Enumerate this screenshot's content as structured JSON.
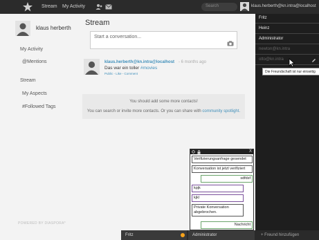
{
  "header": {
    "app_name": "Stream",
    "nav_activity": "My Activity",
    "search_placeholder": "Search",
    "user_label": "klaus.herberth@kn.intra@localhost"
  },
  "sidebar": {
    "profile_name": "klaus herberth",
    "items": [
      "My Activity",
      "@Mentions",
      "Stream",
      "My Aspects",
      "#Followed Tags"
    ],
    "powered_by": "POWERED BY DIASPORA*"
  },
  "stream": {
    "title": "Stream",
    "composer_placeholder": "Start a conversation...",
    "post": {
      "author": "klaus.herberth@kn.intra@localhost",
      "time": "- 6 months ago",
      "text_prefix": "Das war ein toller ",
      "tag": "#movies",
      "meta": "Public - Like - Comment"
    },
    "notice": {
      "line1": "You should add some more contacts!",
      "line2_prefix": "You can search or invite more contacts. Or you can share with ",
      "line2_link": "community spotlight."
    }
  },
  "chat": {
    "close_glyph": "X",
    "messages": [
      {
        "text": "Verifizierungsanfrage gesendet",
        "kind": "in"
      },
      {
        "text": "Konversation ist jetzt verifiziert",
        "kind": "in"
      },
      {
        "text": "sdfdsf",
        "kind": "mine"
      },
      {
        "text": "kpjk",
        "kind": "out"
      },
      {
        "text": "kjkl",
        "kind": "out"
      },
      {
        "text": "Private Konversation abgebrochen.",
        "kind": "in"
      },
      {
        "text": "Nachricht",
        "kind": "input"
      }
    ]
  },
  "roster": {
    "contacts": [
      {
        "name": "Fritz",
        "online": true
      },
      {
        "name": "Heinz",
        "online": true
      },
      {
        "name": "Administrator",
        "online": true
      },
      {
        "name": "newton@kn.intra",
        "online": false
      },
      {
        "name": "otto@kn.intra",
        "online": false
      }
    ],
    "tooltip": "Die Freundschaft ist nur einseitig"
  },
  "dock": {
    "tab1": "Fritz",
    "tab2": "Administrator",
    "add_friend": "+ Freund hinzufügen"
  },
  "colors": {
    "link": "#3f8fba",
    "header_bg": "#2b2b2b",
    "roster_bg": "#1e1e1e",
    "unread_dot": "#f7a21b"
  }
}
